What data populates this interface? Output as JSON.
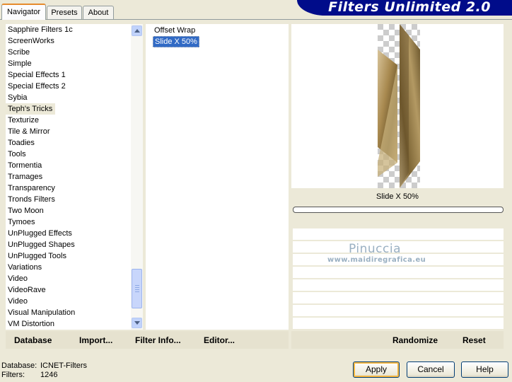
{
  "tabs": [
    {
      "label": "Navigator",
      "active": true
    },
    {
      "label": "Presets",
      "active": false
    },
    {
      "label": "About",
      "active": false
    }
  ],
  "banner_title": "Filters Unlimited 2.0",
  "categories": [
    "Sapphire Filters 1c",
    "ScreenWorks",
    "Scribe",
    "Simple",
    "Special Effects 1",
    "Special Effects 2",
    "Sybia",
    "Teph's Tricks",
    "Texturize",
    "Tile & Mirror",
    "Toadies",
    "Tools",
    "Tormentia",
    "Tramages",
    "Transparency",
    "Tronds Filters",
    "Two Moon",
    "Tymoes",
    "UnPlugged Effects",
    "UnPlugged Shapes",
    "UnPlugged Tools",
    "Variations",
    "Video",
    "VideoRave",
    "Video",
    "Visual Manipulation",
    "VM Distortion"
  ],
  "selected_category": "Teph's Tricks",
  "filters": [
    "Offset Wrap",
    "Slide X 50%"
  ],
  "selected_filter": "Slide X 50%",
  "preview_label": "Slide X 50%",
  "watermark": {
    "name": "Pinuccia",
    "url": "www.maidiregrafica.eu"
  },
  "left_bar": {
    "database": "Database",
    "import": "Import...",
    "filter_info": "Filter Info...",
    "editor": "Editor..."
  },
  "right_bar": {
    "randomize": "Randomize",
    "reset": "Reset"
  },
  "status": {
    "database_label": "Database:",
    "database_value": "ICNET-Filters",
    "filters_label": "Filters:",
    "filters_value": "1246"
  },
  "buttons": {
    "apply": "Apply",
    "cancel": "Cancel",
    "help": "Help"
  },
  "colors": {
    "banner": "#000c8a",
    "selection": "#316ac5",
    "dialog": "#ece9d8",
    "tab_accent": "#e68b2c"
  },
  "scroll_position": 0.88
}
